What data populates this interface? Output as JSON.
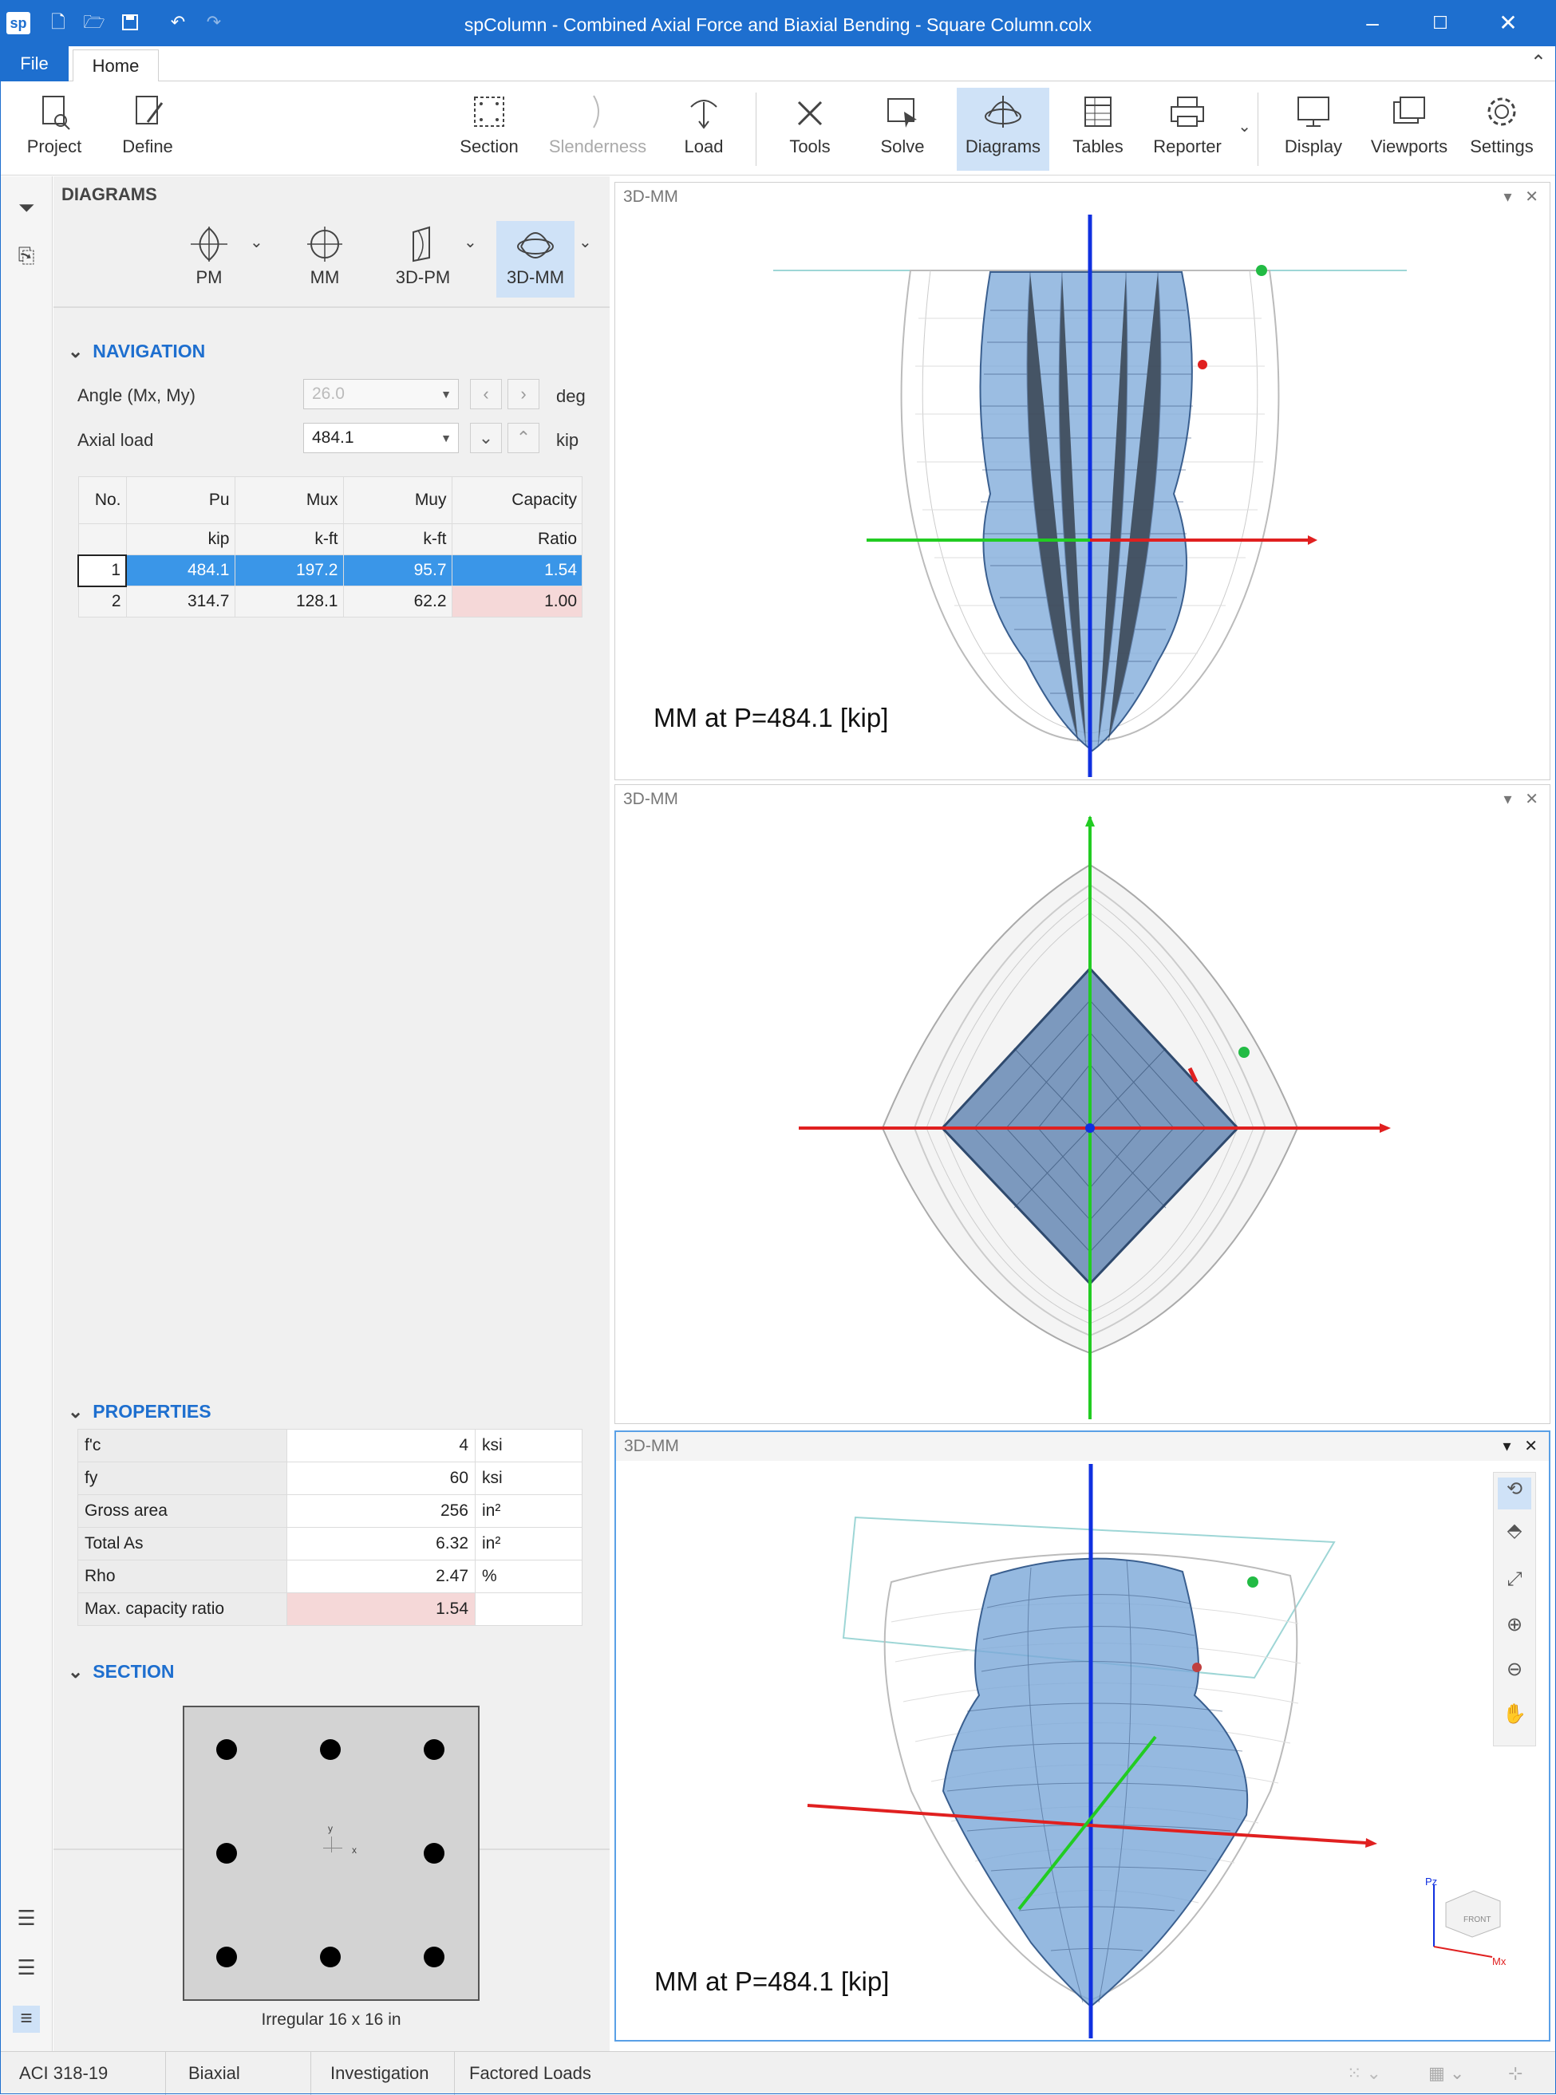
{
  "app": {
    "logo": "sp",
    "title": "spColumn - Combined Axial Force and Biaxial Bending - Square Column.colx"
  },
  "tabs": {
    "file": "File",
    "home": "Home"
  },
  "ribbon": {
    "project": "Project",
    "define": "Define",
    "section": "Section",
    "slenderness": "Slenderness",
    "load": "Load",
    "tools": "Tools",
    "solve": "Solve",
    "diagrams": "Diagrams",
    "tables": "Tables",
    "reporter": "Reporter",
    "display": "Display",
    "viewports": "Viewports",
    "settings": "Settings"
  },
  "panel": {
    "title": "DIAGRAMS",
    "diagram_buttons": [
      "PM",
      "MM",
      "3D-PM",
      "3D-MM"
    ],
    "active_diagram": "3D-MM",
    "navigation": {
      "heading": "NAVIGATION",
      "angle_label": "Angle (Mx, My)",
      "angle_value": "26.0",
      "angle_unit": "deg",
      "axial_label": "Axial load",
      "axial_value": "484.1",
      "axial_unit": "kip"
    },
    "results": {
      "headers": [
        "No.",
        "Pu",
        "Mux",
        "Muy",
        "Capacity"
      ],
      "units": [
        "",
        "kip",
        "k-ft",
        "k-ft",
        "Ratio"
      ],
      "rows": [
        [
          "1",
          "484.1",
          "197.2",
          "95.7",
          "1.54"
        ],
        [
          "2",
          "314.7",
          "128.1",
          "62.2",
          "1.00"
        ]
      ]
    },
    "properties": {
      "heading": "PROPERTIES",
      "rows": [
        [
          "f'c",
          "4",
          "ksi"
        ],
        [
          "fy",
          "60",
          "ksi"
        ],
        [
          "Gross area",
          "256",
          "in²"
        ],
        [
          "Total As",
          "6.32",
          "in²"
        ],
        [
          "Rho",
          "2.47",
          "%"
        ],
        [
          "Max. capacity ratio",
          "1.54",
          ""
        ]
      ]
    },
    "section": {
      "heading": "SECTION",
      "caption": "Irregular 16 x 16 in",
      "axis_y": "y",
      "axis_x": "x"
    }
  },
  "viewports": [
    {
      "title": "3D-MM",
      "caption": "MM at P=484.1 [kip]"
    },
    {
      "title": "3D-MM",
      "caption": ""
    },
    {
      "title": "3D-MM",
      "caption": "MM at P=484.1 [kip]"
    }
  ],
  "viewcube": {
    "face": "FRONT",
    "pz": "Pz",
    "mx": "Mx"
  },
  "status": {
    "code": "ACI 318-19",
    "bending": "Biaxial",
    "mode": "Investigation",
    "loads": "Factored Loads"
  },
  "colors": {
    "accent": "#1e6fcf",
    "selected_row": "#3a96e8",
    "highlight": "#f5d8d8",
    "surface": "#7aa7d8"
  }
}
